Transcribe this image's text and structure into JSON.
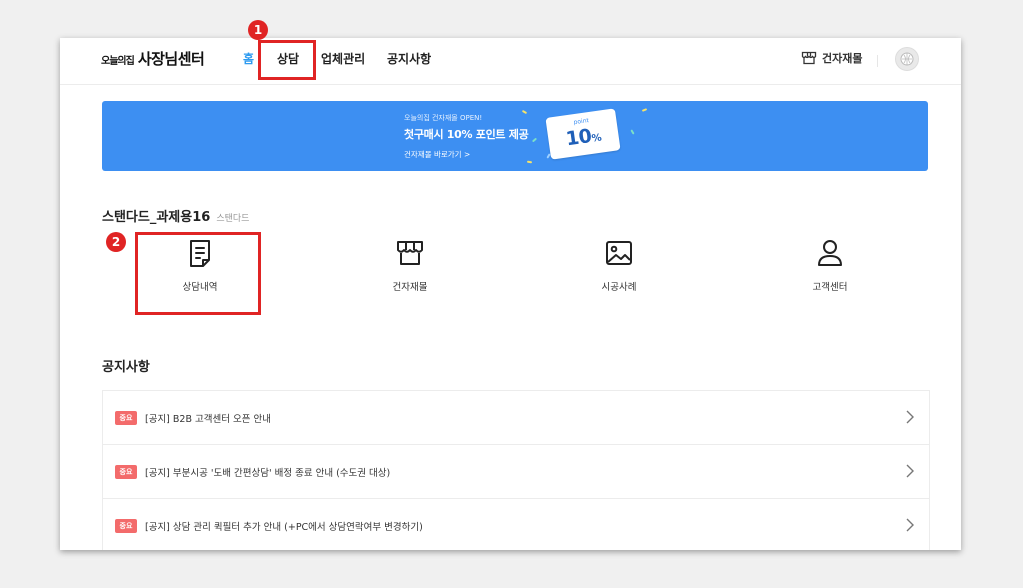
{
  "header": {
    "logo_small": "오늘의집",
    "logo_big": "사장님센터",
    "nav": [
      "홈",
      "상담",
      "업체관리",
      "공지사항"
    ],
    "right_link": "건자재몰"
  },
  "banner": {
    "line1": "오늘의집 건자재몰 OPEN!",
    "line2": "첫구매시 10% 포인트 제공",
    "line3": "건자재몰 바로가기 >",
    "ticket_label": "point",
    "ticket_value": "10",
    "ticket_unit": "%"
  },
  "business": {
    "name": "스탠다드_과제용16",
    "grade": "스탠다드"
  },
  "quick_menu": [
    "상담내역",
    "건자재몰",
    "시공사례",
    "고객센터"
  ],
  "notices": {
    "title": "공지사항",
    "badge": "중요",
    "items": [
      "[공지] B2B 고객센터 오픈 안내",
      "[공지] 부분시공 '도배 간편상담' 배정 종료 안내 (수도권 대상)",
      "[공지] 상담 관리 퀵필터 추가 안내 (+PC에서 상담연락여부 변경하기)"
    ]
  },
  "annotations": {
    "step1": "1",
    "step2": "2",
    "color": "#e02424"
  },
  "colors": {
    "accent": "#2d9bf0",
    "banner": "#3d8ff2",
    "badge": "#f36b6b"
  }
}
